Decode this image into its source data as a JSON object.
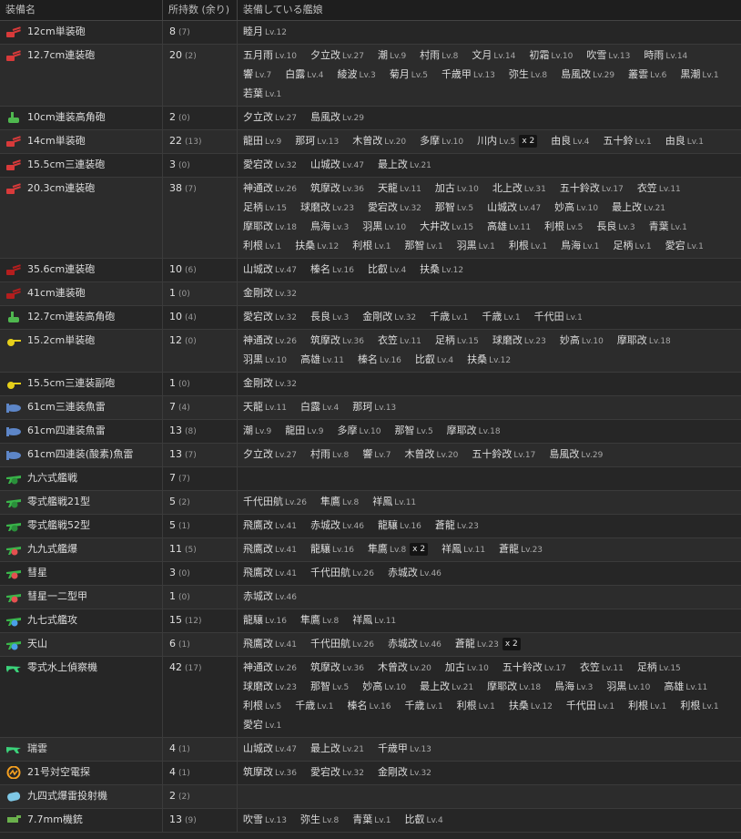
{
  "headers": {
    "name": "装備名",
    "count": "所持数 (余り)",
    "ships": "装備している艦娘"
  },
  "icon_colors": {
    "red-gun": "#d83a3a",
    "darkred-gun": "#b51e1e",
    "green-gun": "#4fb84f",
    "yellow-gun": "#e6cf1a",
    "torpedo": "#5d86c8",
    "fighter": "#3ab54a",
    "bomber": "#3ab54a",
    "attacker": "#3ab54a",
    "seaplane": "#3bd27a",
    "radar": "#f5a020",
    "depth-charge": "#7ec8e6",
    "aa-gun": "#6ab04c"
  },
  "rows": [
    {
      "icon": "red-gun",
      "name": "12cm単装砲",
      "count": "8",
      "rest": "(7)",
      "ships": [
        {
          "n": "睦月",
          "lv": "Lv.12"
        }
      ]
    },
    {
      "icon": "red-gun",
      "name": "12.7cm連装砲",
      "count": "20",
      "rest": "(2)",
      "ships": [
        {
          "n": "五月雨",
          "lv": "Lv.10"
        },
        {
          "n": "夕立改",
          "lv": "Lv.27"
        },
        {
          "n": "潮",
          "lv": "Lv.9"
        },
        {
          "n": "村雨",
          "lv": "Lv.8"
        },
        {
          "n": "文月",
          "lv": "Lv.14"
        },
        {
          "n": "初霜",
          "lv": "Lv.10"
        },
        {
          "n": "吹雪",
          "lv": "Lv.13"
        },
        {
          "n": "時雨",
          "lv": "Lv.14"
        },
        {
          "n": "響",
          "lv": "Lv.7"
        },
        {
          "n": "白露",
          "lv": "Lv.4"
        },
        {
          "n": "綾波",
          "lv": "Lv.3"
        },
        {
          "n": "菊月",
          "lv": "Lv.5"
        },
        {
          "n": "千歳甲",
          "lv": "Lv.13"
        },
        {
          "n": "弥生",
          "lv": "Lv.8"
        },
        {
          "n": "島風改",
          "lv": "Lv.29"
        },
        {
          "n": "叢雲",
          "lv": "Lv.6"
        },
        {
          "n": "黒潮",
          "lv": "Lv.1"
        },
        {
          "n": "若葉",
          "lv": "Lv.1"
        }
      ]
    },
    {
      "icon": "green-gun",
      "name": "10cm連装高角砲",
      "count": "2",
      "rest": "(0)",
      "ships": [
        {
          "n": "夕立改",
          "lv": "Lv.27"
        },
        {
          "n": "島風改",
          "lv": "Lv.29"
        }
      ]
    },
    {
      "icon": "red-gun",
      "name": "14cm単装砲",
      "count": "22",
      "rest": "(13)",
      "ships": [
        {
          "n": "龍田",
          "lv": "Lv.9"
        },
        {
          "n": "那珂",
          "lv": "Lv.13"
        },
        {
          "n": "木曾改",
          "lv": "Lv.20"
        },
        {
          "n": "多摩",
          "lv": "Lv.10"
        },
        {
          "n": "川内",
          "lv": "Lv.5",
          "x": "x 2"
        },
        {
          "n": "由良",
          "lv": "Lv.4"
        },
        {
          "n": "五十鈴",
          "lv": "Lv.1"
        },
        {
          "n": "由良",
          "lv": "Lv.1"
        }
      ]
    },
    {
      "icon": "red-gun",
      "name": "15.5cm三連装砲",
      "count": "3",
      "rest": "(0)",
      "ships": [
        {
          "n": "愛宕改",
          "lv": "Lv.32"
        },
        {
          "n": "山城改",
          "lv": "Lv.47"
        },
        {
          "n": "最上改",
          "lv": "Lv.21"
        }
      ]
    },
    {
      "icon": "red-gun",
      "name": "20.3cm連装砲",
      "count": "38",
      "rest": "(7)",
      "ships": [
        {
          "n": "神通改",
          "lv": "Lv.26"
        },
        {
          "n": "筑摩改",
          "lv": "Lv.36"
        },
        {
          "n": "天龍",
          "lv": "Lv.11"
        },
        {
          "n": "加古",
          "lv": "Lv.10"
        },
        {
          "n": "北上改",
          "lv": "Lv.31"
        },
        {
          "n": "五十鈴改",
          "lv": "Lv.17"
        },
        {
          "n": "衣笠",
          "lv": "Lv.11"
        },
        {
          "n": "足柄",
          "lv": "Lv.15"
        },
        {
          "n": "球磨改",
          "lv": "Lv.23"
        },
        {
          "n": "愛宕改",
          "lv": "Lv.32"
        },
        {
          "n": "那智",
          "lv": "Lv.5"
        },
        {
          "n": "山城改",
          "lv": "Lv.47"
        },
        {
          "n": "妙高",
          "lv": "Lv.10"
        },
        {
          "n": "最上改",
          "lv": "Lv.21"
        },
        {
          "n": "摩耶改",
          "lv": "Lv.18"
        },
        {
          "n": "鳥海",
          "lv": "Lv.3"
        },
        {
          "n": "羽黒",
          "lv": "Lv.10"
        },
        {
          "n": "大井改",
          "lv": "Lv.15"
        },
        {
          "n": "高雄",
          "lv": "Lv.11"
        },
        {
          "n": "利根",
          "lv": "Lv.5"
        },
        {
          "n": "長良",
          "lv": "Lv.3"
        },
        {
          "n": "青葉",
          "lv": "Lv.1"
        },
        {
          "n": "利根",
          "lv": "Lv.1"
        },
        {
          "n": "扶桑",
          "lv": "Lv.12"
        },
        {
          "n": "利根",
          "lv": "Lv.1"
        },
        {
          "n": "那智",
          "lv": "Lv.1"
        },
        {
          "n": "羽黒",
          "lv": "Lv.1"
        },
        {
          "n": "利根",
          "lv": "Lv.1"
        },
        {
          "n": "鳥海",
          "lv": "Lv.1"
        },
        {
          "n": "足柄",
          "lv": "Lv.1"
        },
        {
          "n": "愛宕",
          "lv": "Lv.1"
        }
      ]
    },
    {
      "icon": "darkred-gun",
      "name": "35.6cm連装砲",
      "count": "10",
      "rest": "(6)",
      "ships": [
        {
          "n": "山城改",
          "lv": "Lv.47"
        },
        {
          "n": "榛名",
          "lv": "Lv.16"
        },
        {
          "n": "比叡",
          "lv": "Lv.4"
        },
        {
          "n": "扶桑",
          "lv": "Lv.12"
        }
      ]
    },
    {
      "icon": "darkred-gun",
      "name": "41cm連装砲",
      "count": "1",
      "rest": "(0)",
      "ships": [
        {
          "n": "金剛改",
          "lv": "Lv.32"
        }
      ]
    },
    {
      "icon": "green-gun",
      "name": "12.7cm連装高角砲",
      "count": "10",
      "rest": "(4)",
      "ships": [
        {
          "n": "愛宕改",
          "lv": "Lv.32"
        },
        {
          "n": "長良",
          "lv": "Lv.3"
        },
        {
          "n": "金剛改",
          "lv": "Lv.32"
        },
        {
          "n": "千歳",
          "lv": "Lv.1"
        },
        {
          "n": "千歳",
          "lv": "Lv.1"
        },
        {
          "n": "千代田",
          "lv": "Lv.1"
        }
      ]
    },
    {
      "icon": "yellow-gun",
      "name": "15.2cm単装砲",
      "count": "12",
      "rest": "(0)",
      "ships": [
        {
          "n": "神通改",
          "lv": "Lv.26"
        },
        {
          "n": "筑摩改",
          "lv": "Lv.36"
        },
        {
          "n": "衣笠",
          "lv": "Lv.11"
        },
        {
          "n": "足柄",
          "lv": "Lv.15"
        },
        {
          "n": "球磨改",
          "lv": "Lv.23"
        },
        {
          "n": "妙高",
          "lv": "Lv.10"
        },
        {
          "n": "摩耶改",
          "lv": "Lv.18"
        },
        {
          "n": "羽黒",
          "lv": "Lv.10"
        },
        {
          "n": "高雄",
          "lv": "Lv.11"
        },
        {
          "n": "榛名",
          "lv": "Lv.16"
        },
        {
          "n": "比叡",
          "lv": "Lv.4"
        },
        {
          "n": "扶桑",
          "lv": "Lv.12"
        }
      ]
    },
    {
      "icon": "yellow-gun",
      "name": "15.5cm三連装副砲",
      "count": "1",
      "rest": "(0)",
      "ships": [
        {
          "n": "金剛改",
          "lv": "Lv.32"
        }
      ]
    },
    {
      "icon": "torpedo",
      "name": "61cm三連装魚雷",
      "count": "7",
      "rest": "(4)",
      "ships": [
        {
          "n": "天龍",
          "lv": "Lv.11"
        },
        {
          "n": "白露",
          "lv": "Lv.4"
        },
        {
          "n": "那珂",
          "lv": "Lv.13"
        }
      ]
    },
    {
      "icon": "torpedo",
      "name": "61cm四連装魚雷",
      "count": "13",
      "rest": "(8)",
      "ships": [
        {
          "n": "潮",
          "lv": "Lv.9"
        },
        {
          "n": "龍田",
          "lv": "Lv.9"
        },
        {
          "n": "多摩",
          "lv": "Lv.10"
        },
        {
          "n": "那智",
          "lv": "Lv.5"
        },
        {
          "n": "摩耶改",
          "lv": "Lv.18"
        }
      ]
    },
    {
      "icon": "torpedo",
      "name": "61cm四連装(酸素)魚雷",
      "count": "13",
      "rest": "(7)",
      "ships": [
        {
          "n": "夕立改",
          "lv": "Lv.27"
        },
        {
          "n": "村雨",
          "lv": "Lv.8"
        },
        {
          "n": "響",
          "lv": "Lv.7"
        },
        {
          "n": "木曾改",
          "lv": "Lv.20"
        },
        {
          "n": "五十鈴改",
          "lv": "Lv.17"
        },
        {
          "n": "島風改",
          "lv": "Lv.29"
        }
      ]
    },
    {
      "icon": "fighter",
      "name": "九六式艦戦",
      "count": "7",
      "rest": "(7)",
      "ships": []
    },
    {
      "icon": "fighter",
      "name": "零式艦戦21型",
      "count": "5",
      "rest": "(2)",
      "ships": [
        {
          "n": "千代田航",
          "lv": "Lv.26"
        },
        {
          "n": "隼鷹",
          "lv": "Lv.8"
        },
        {
          "n": "祥鳳",
          "lv": "Lv.11"
        }
      ]
    },
    {
      "icon": "fighter",
      "name": "零式艦戦52型",
      "count": "5",
      "rest": "(1)",
      "ships": [
        {
          "n": "飛鷹改",
          "lv": "Lv.41"
        },
        {
          "n": "赤城改",
          "lv": "Lv.46"
        },
        {
          "n": "龍驤",
          "lv": "Lv.16"
        },
        {
          "n": "蒼龍",
          "lv": "Lv.23"
        }
      ]
    },
    {
      "icon": "bomber",
      "name": "九九式艦爆",
      "count": "11",
      "rest": "(5)",
      "ships": [
        {
          "n": "飛鷹改",
          "lv": "Lv.41"
        },
        {
          "n": "龍驤",
          "lv": "Lv.16"
        },
        {
          "n": "隼鷹",
          "lv": "Lv.8",
          "x": "x 2"
        },
        {
          "n": "祥鳳",
          "lv": "Lv.11"
        },
        {
          "n": "蒼龍",
          "lv": "Lv.23"
        }
      ]
    },
    {
      "icon": "bomber",
      "name": "彗星",
      "count": "3",
      "rest": "(0)",
      "ships": [
        {
          "n": "飛鷹改",
          "lv": "Lv.41"
        },
        {
          "n": "千代田航",
          "lv": "Lv.26"
        },
        {
          "n": "赤城改",
          "lv": "Lv.46"
        }
      ]
    },
    {
      "icon": "bomber",
      "name": "彗星一二型甲",
      "count": "1",
      "rest": "(0)",
      "ships": [
        {
          "n": "赤城改",
          "lv": "Lv.46"
        }
      ]
    },
    {
      "icon": "attacker",
      "name": "九七式艦攻",
      "count": "15",
      "rest": "(12)",
      "ships": [
        {
          "n": "龍驤",
          "lv": "Lv.16"
        },
        {
          "n": "隼鷹",
          "lv": "Lv.8"
        },
        {
          "n": "祥鳳",
          "lv": "Lv.11"
        }
      ]
    },
    {
      "icon": "attacker",
      "name": "天山",
      "count": "6",
      "rest": "(1)",
      "ships": [
        {
          "n": "飛鷹改",
          "lv": "Lv.41"
        },
        {
          "n": "千代田航",
          "lv": "Lv.26"
        },
        {
          "n": "赤城改",
          "lv": "Lv.46"
        },
        {
          "n": "蒼龍",
          "lv": "Lv.23",
          "x": "x 2"
        }
      ]
    },
    {
      "icon": "seaplane",
      "name": "零式水上偵察機",
      "count": "42",
      "rest": "(17)",
      "ships": [
        {
          "n": "神通改",
          "lv": "Lv.26"
        },
        {
          "n": "筑摩改",
          "lv": "Lv.36"
        },
        {
          "n": "木曾改",
          "lv": "Lv.20"
        },
        {
          "n": "加古",
          "lv": "Lv.10"
        },
        {
          "n": "五十鈴改",
          "lv": "Lv.17"
        },
        {
          "n": "衣笠",
          "lv": "Lv.11"
        },
        {
          "n": "足柄",
          "lv": "Lv.15"
        },
        {
          "n": "球磨改",
          "lv": "Lv.23"
        },
        {
          "n": "那智",
          "lv": "Lv.5"
        },
        {
          "n": "妙高",
          "lv": "Lv.10"
        },
        {
          "n": "最上改",
          "lv": "Lv.21"
        },
        {
          "n": "摩耶改",
          "lv": "Lv.18"
        },
        {
          "n": "鳥海",
          "lv": "Lv.3"
        },
        {
          "n": "羽黒",
          "lv": "Lv.10"
        },
        {
          "n": "高雄",
          "lv": "Lv.11"
        },
        {
          "n": "利根",
          "lv": "Lv.5"
        },
        {
          "n": "千歳",
          "lv": "Lv.1"
        },
        {
          "n": "榛名",
          "lv": "Lv.16"
        },
        {
          "n": "千歳",
          "lv": "Lv.1"
        },
        {
          "n": "利根",
          "lv": "Lv.1"
        },
        {
          "n": "扶桑",
          "lv": "Lv.12"
        },
        {
          "n": "千代田",
          "lv": "Lv.1"
        },
        {
          "n": "利根",
          "lv": "Lv.1"
        },
        {
          "n": "利根",
          "lv": "Lv.1"
        },
        {
          "n": "愛宕",
          "lv": "Lv.1"
        }
      ]
    },
    {
      "icon": "seaplane",
      "name": "瑞雲",
      "count": "4",
      "rest": "(1)",
      "ships": [
        {
          "n": "山城改",
          "lv": "Lv.47"
        },
        {
          "n": "最上改",
          "lv": "Lv.21"
        },
        {
          "n": "千歳甲",
          "lv": "Lv.13"
        }
      ]
    },
    {
      "icon": "radar",
      "name": "21号対空電探",
      "count": "4",
      "rest": "(1)",
      "ships": [
        {
          "n": "筑摩改",
          "lv": "Lv.36"
        },
        {
          "n": "愛宕改",
          "lv": "Lv.32"
        },
        {
          "n": "金剛改",
          "lv": "Lv.32"
        }
      ]
    },
    {
      "icon": "depth-charge",
      "name": "九四式爆雷投射機",
      "count": "2",
      "rest": "(2)",
      "ships": []
    },
    {
      "icon": "aa-gun",
      "name": "7.7mm機銃",
      "count": "13",
      "rest": "(9)",
      "ships": [
        {
          "n": "吹雪",
          "lv": "Lv.13"
        },
        {
          "n": "弥生",
          "lv": "Lv.8"
        },
        {
          "n": "青葉",
          "lv": "Lv.1"
        },
        {
          "n": "比叡",
          "lv": "Lv.4"
        }
      ]
    }
  ]
}
